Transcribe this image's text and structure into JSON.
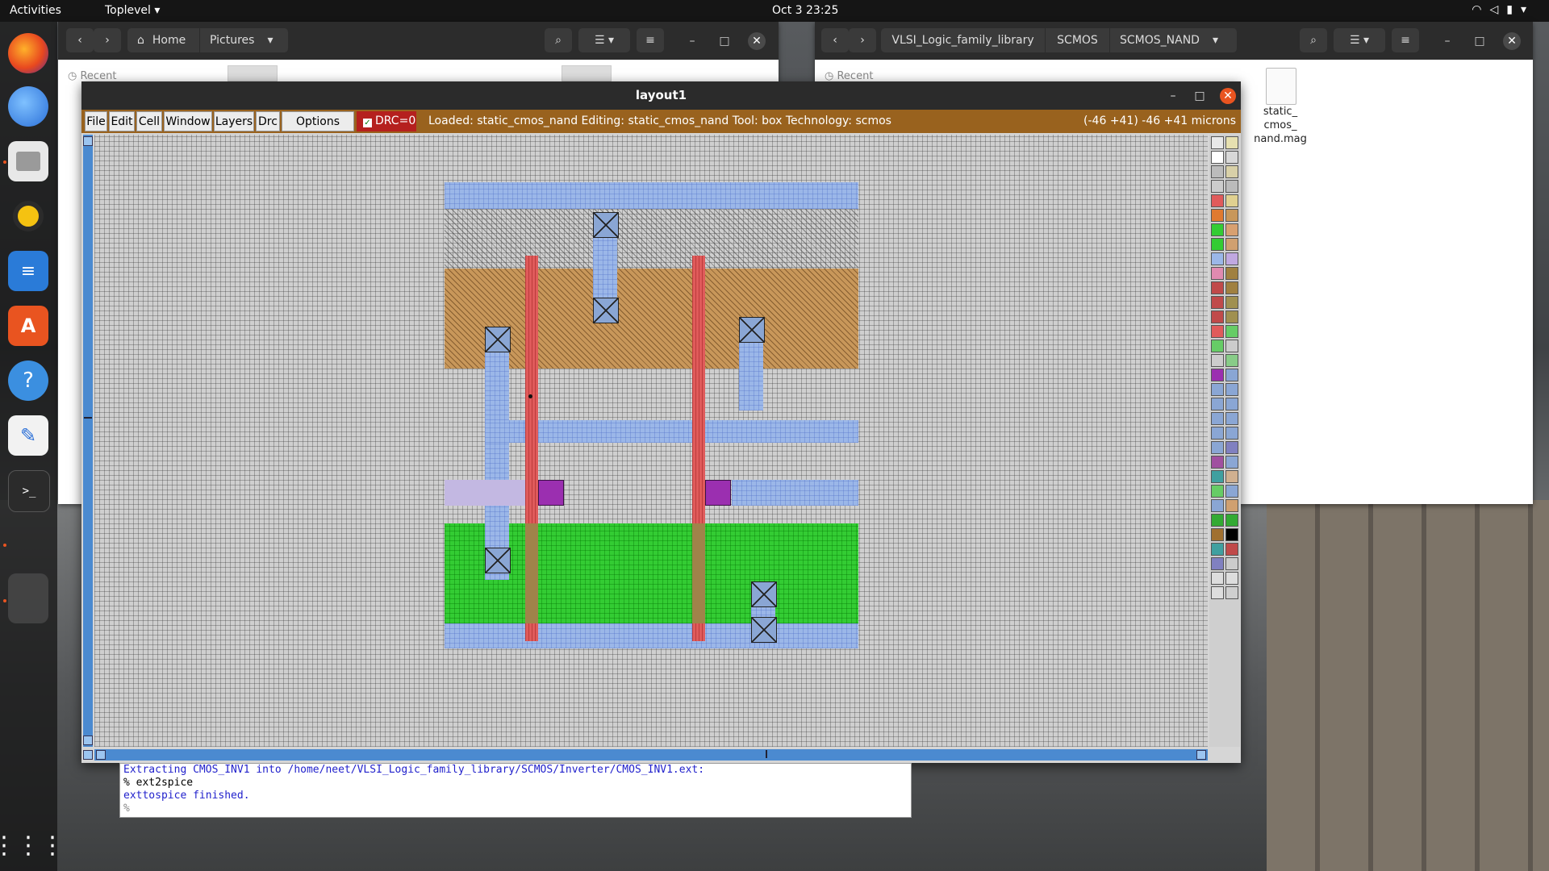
{
  "topbar": {
    "activities": "Activities",
    "app_menu": "Toplevel ▾",
    "clock": "Oct 3  23:25",
    "tray_icons": [
      "wifi-icon",
      "volume-icon",
      "battery-icon",
      "system-menu-icon"
    ]
  },
  "dock": {
    "items": [
      "firefox",
      "thunderbird",
      "files",
      "rhythmbox",
      "libreoffice-writer",
      "ubuntu-software",
      "help",
      "text-editor",
      "terminal"
    ],
    "show_apps_icon": "show-apps-grid-icon"
  },
  "nautilus_left": {
    "crumbs": [
      "Home",
      "Pictures"
    ],
    "sidebar_recent": "Recent"
  },
  "nautilus_right": {
    "crumbs": [
      "VLSI_Logic_family_library",
      "SCMOS",
      "SCMOS_NAND"
    ],
    "sidebar_recent": "Recent",
    "file": {
      "label_lines": [
        "static_",
        "cmos_",
        "nand.mag"
      ]
    }
  },
  "magic": {
    "title": "layout1",
    "menus": [
      "File",
      "Edit",
      "Cell",
      "Window",
      "Layers",
      "Drc",
      "Options"
    ],
    "drc": "DRC=0",
    "status": "Loaded: static_cmos_nand  Editing: static_cmos_nand  Tool: box   Technology: scmos",
    "coords": "(-46 +41) -46 +41 microns",
    "accent_color": "#99621e"
  },
  "terminal": {
    "lines": [
      {
        "text": "Extracting CMOS_INV1 into /home/neet/VLSI_Logic_family_library/SCMOS/Inverter/CMOS_INV1.ext:",
        "style": "blue"
      },
      {
        "text": "% ext2spice",
        "style": "black"
      },
      {
        "text": "exttospice finished.",
        "style": "blue"
      },
      {
        "text": "%",
        "style": "gray"
      }
    ]
  }
}
